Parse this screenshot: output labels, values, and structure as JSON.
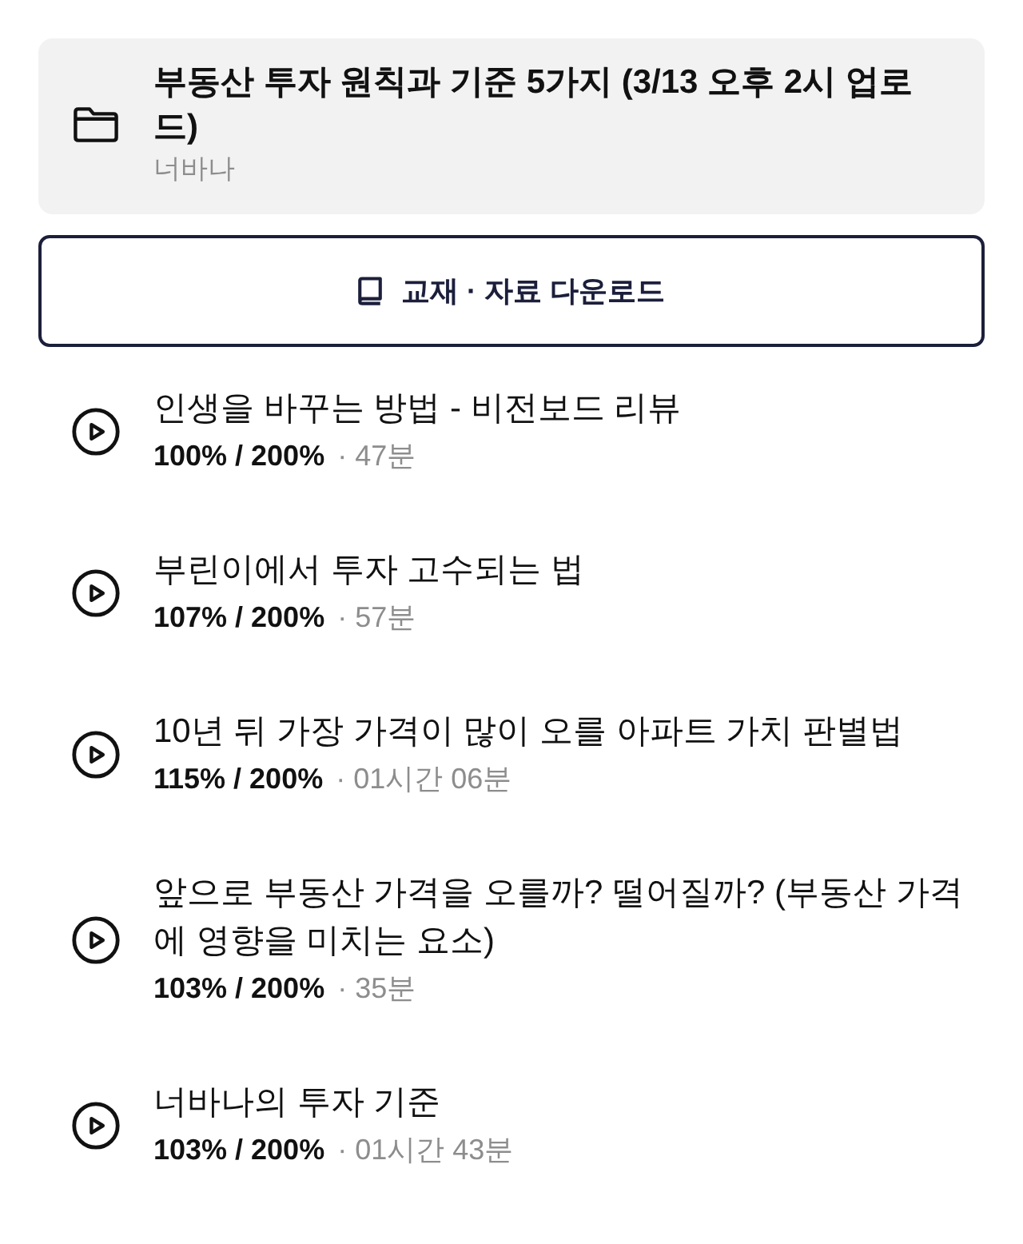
{
  "folder": {
    "title": "부동산 투자 원칙과 기준 5가지 (3/13 오후 2시 업로드)",
    "author": "너바나"
  },
  "download_button": {
    "label": "교재 · 자료 다운로드"
  },
  "lectures": [
    {
      "title": "인생을 바꾸는 방법 - 비전보드 리뷰",
      "progress": "100% / 200%",
      "duration": "· 47분"
    },
    {
      "title": "부린이에서 투자 고수되는 법",
      "progress": "107% / 200%",
      "duration": "· 57분"
    },
    {
      "title": "10년 뒤 가장 가격이 많이 오를 아파트 가치 판별법",
      "progress": "115% / 200%",
      "duration": "· 01시간 06분"
    },
    {
      "title": "앞으로 부동산 가격을 오를까? 떨어질까? (부동산 가격에 영향을 미치는 요소)",
      "progress": "103% / 200%",
      "duration": "· 35분"
    },
    {
      "title": "너바나의 투자 기준",
      "progress": "103% / 200%",
      "duration": "· 01시간 43분"
    }
  ]
}
